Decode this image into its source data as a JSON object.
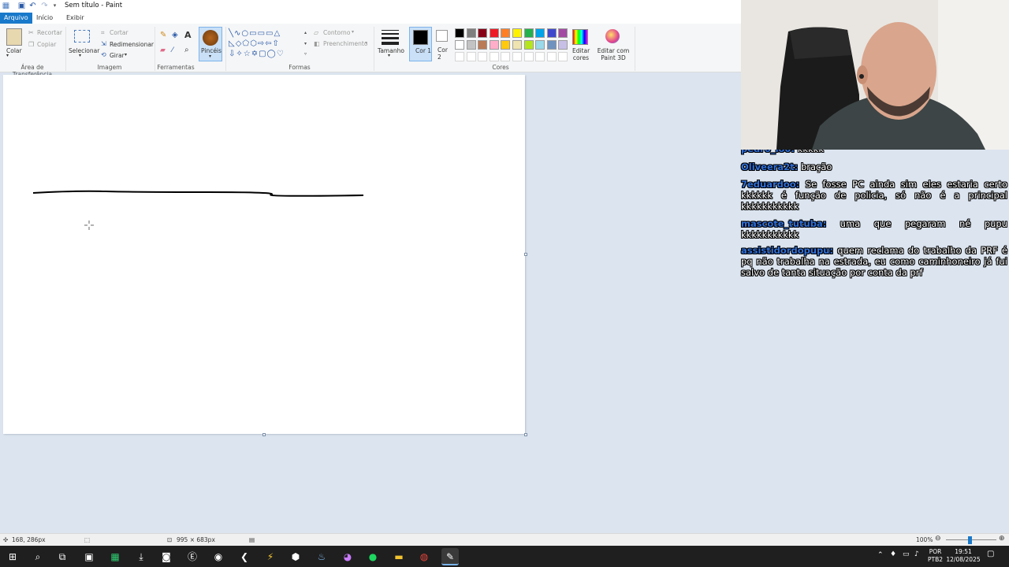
{
  "window": {
    "title": "Sem título - Paint"
  },
  "tabs": [
    "Arquivo",
    "Início",
    "Exibir"
  ],
  "ribbon": {
    "clipboard": {
      "paste": "Colar",
      "cut": "Recortar",
      "copy": "Copiar",
      "group": "Área de Transferência"
    },
    "image": {
      "select": "Selecionar",
      "crop": "Cortar",
      "resize": "Redimensionar",
      "rotate": "Girar",
      "group": "Imagem"
    },
    "tools": {
      "group": "Ferramentas"
    },
    "brushes": {
      "label": "Pincéis"
    },
    "shapes": {
      "outline": "Contorno",
      "fill": "Preenchimento",
      "group": "Formas"
    },
    "size": {
      "label": "Tamanho"
    },
    "colors": {
      "color1": "Cor 1",
      "color2": "Cor 2",
      "edit": "Editar cores",
      "paint3d": "Editar com Paint 3D",
      "group": "Cores",
      "row1": [
        "#000000",
        "#7f7f7f",
        "#880015",
        "#ed1c24",
        "#ff7f27",
        "#fff200",
        "#22b14c",
        "#00a2e8",
        "#3f48cc",
        "#a349a4"
      ],
      "row2": [
        "#ffffff",
        "#c3c3c3",
        "#b97a57",
        "#ffaec9",
        "#ffc90e",
        "#efe4b0",
        "#b5e61d",
        "#99d9ea",
        "#7092be",
        "#c8bfe7"
      ]
    }
  },
  "status": {
    "cursor": "168, 286px",
    "image_size": "995 × 683px",
    "zoom": "100%"
  },
  "taskbar": {
    "lang_top": "POR",
    "lang_bottom": "PTB2",
    "time": "19:51",
    "date": "12/08/2025"
  },
  "chat": [
    {
      "user": "Oliveera2t:",
      "text": "bração"
    },
    {
      "user": "7eduardoo:",
      "text": "Se fosse PC ainda sim eles estaria certo kkkkkk é função de policia, só não é a principal kkkkkkkkkkk"
    },
    {
      "user": "mascote_tutuba:",
      "text": "uma que pegaram né pupu kkkkkkkkkkk"
    },
    {
      "user": "assistidordopupu:",
      "text": "quem reclama do trabalho da PRF é pq não trabalha na estrada, eu como caminhoneiro já fui salvo de tanta situação por conta da prf"
    }
  ]
}
